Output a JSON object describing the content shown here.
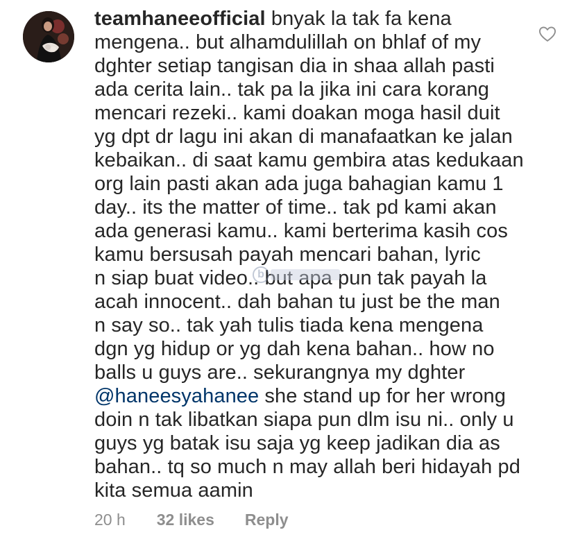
{
  "comment": {
    "username": "teamhaneeofficial",
    "lines": [
      "bnyak la tak fa kena",
      "mengena.. but alhamdulillah on bhlaf of my",
      "dghter setiap tangisan dia in shaa allah pasti",
      "ada cerita lain.. tak pa la jika ini cara korang",
      "mencari rezeki.. kami doakan moga hasil duit",
      "yg dpt dr lagu ini akan di manafaatkan ke jalan",
      "kebaikan.. di saat kamu gembira atas kedukaan",
      "org lain pasti akan ada juga bahagian kamu 1",
      "day.. its the matter of time.. tak pd kami akan",
      "ada generasi kamu.. kami berterima kasih cos",
      "kamu bersusah payah mencari bahan, lyric",
      "n siap buat video.. but apa pun tak payah la",
      "acah innocent.. dah bahan tu just be the man",
      "n say so.. tak yah tulis tiada kena mengena",
      "dgn yg hidup or yg dah kena bahan.. how no",
      "balls u guys are.. sekurangnya my dghter"
    ],
    "mention": "@haneesyahanee",
    "mention_rest": " she stand up for her wrong",
    "lines_after": [
      "doin n tak libatkan siapa pun dlm isu ni.. only u",
      "guys yg batak isu saja yg keep jadikan dia as",
      "bahan.. tq so much n may allah beri hidayah pd",
      "kita semua aamin"
    ],
    "time": "20 h",
    "likes": "32 likes",
    "reply": "Reply",
    "heart_icon": "heart-outline-icon"
  },
  "colors": {
    "text": "#262626",
    "meta": "#8e8e8e",
    "mention": "#003569"
  }
}
